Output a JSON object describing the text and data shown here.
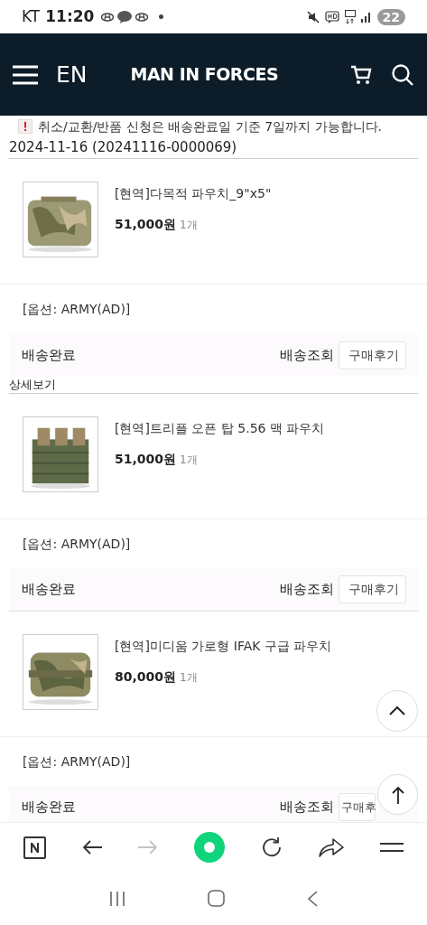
{
  "status_bar": {
    "carrier": "KT",
    "time": "11:20",
    "battery": "22"
  },
  "header": {
    "language": "EN",
    "logo": "MAN IN FORCES"
  },
  "notice": "취소/교환/반품 신청은 배송완료일 기준 7일까지 가능합니다.",
  "order": {
    "date": "2024-11-16 (20241116-0000069)"
  },
  "items": [
    {
      "kind": "picture",
      "title": "[현역]다목적 파우치_9\"x5\"",
      "price": "51,000원",
      "quantity": "1개",
      "option": "[옵션: ARMY(AD)]",
      "status": "배송완료",
      "tracking": "배송조회",
      "review": "구매후기",
      "details": "상세보기"
    },
    {
      "kind": "picture",
      "title": "[현역]트리플 오픈 탑 5.56 맥 파우치",
      "price": "51,000원",
      "quantity": "1개",
      "option": "[옵션: ARMY(AD)]",
      "status": "배송완료",
      "tracking": "배송조회",
      "review": "구매후기"
    },
    {
      "kind": "picture",
      "title": "[현역]미디움 가로형 IFAK 구급 파우치",
      "price": "80,000원",
      "quantity": "1개",
      "option": "[옵션: ARMY(AD)]",
      "status": "배송완료",
      "tracking": "배송조회",
      "review": "구매후"
    }
  ],
  "browser_toolbar": {
    "forward_disabled": true
  }
}
